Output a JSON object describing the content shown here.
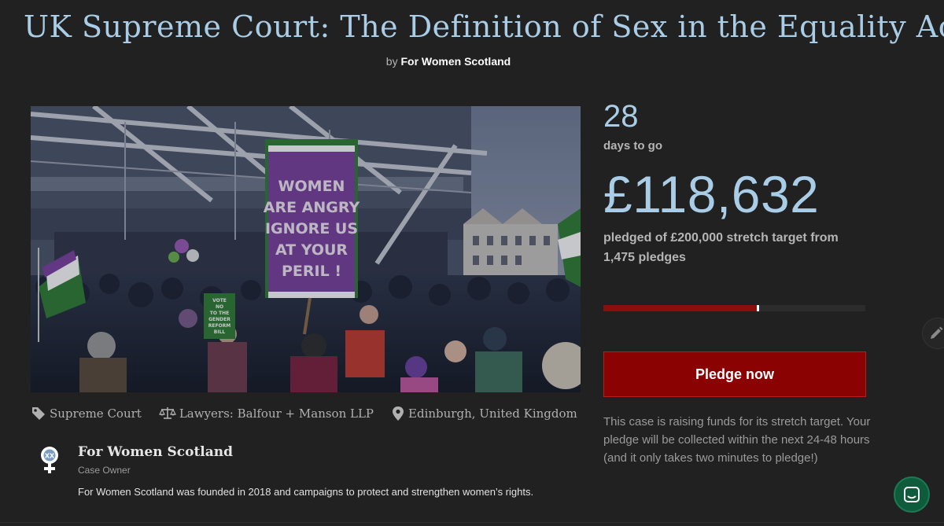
{
  "page": {
    "title": "UK Supreme Court: The Definition of Sex in the Equality Act",
    "byline_prefix": "by",
    "byline_org": "For Women Scotland"
  },
  "hero": {
    "placard_lines": [
      "WOMEN",
      "ARE ANGRY",
      "IGNORE US",
      "AT YOUR",
      "PERIL !"
    ],
    "small_placard_lines": [
      "VOTE",
      "NO",
      "TO THE",
      "GENDER",
      "REFORM",
      "BILL"
    ]
  },
  "meta": {
    "category": "Supreme Court",
    "lawyers": "Lawyers: Balfour + Manson LLP",
    "location": "Edinburgh, United Kingdom",
    "icons": [
      "tag-icon",
      "scales-icon",
      "location-pin-icon"
    ]
  },
  "owner": {
    "name": "For Women Scotland",
    "role": "Case Owner",
    "description": "For Women Scotland was founded in 2018 and campaigns to protect and strengthen women’s rights.",
    "avatar_icon": "venus-xx-icon"
  },
  "stats": {
    "days_number": "28",
    "days_label": "days to go",
    "amount": "£118,632",
    "pledged_line1": "pledged of £200,000 stretch target from",
    "pledged_line2": "1,475 pledges",
    "progress_fraction": 0.593
  },
  "cta": {
    "pledge_label": "Pledge now",
    "info": "This case is raising funds for its stretch target. Your pledge will be collected within the next 24-48 hours (and it only takes two minutes to pledge!)"
  },
  "widgets": {
    "edit_icon": "pencil-icon",
    "chat_icon": "chat-icon"
  },
  "colors": {
    "background": "#212121",
    "accent_blue": "#a9cde6",
    "cta_red": "#8b0202",
    "progress_red": "#8b0f0f",
    "chat_green": "#0f5c3c"
  }
}
